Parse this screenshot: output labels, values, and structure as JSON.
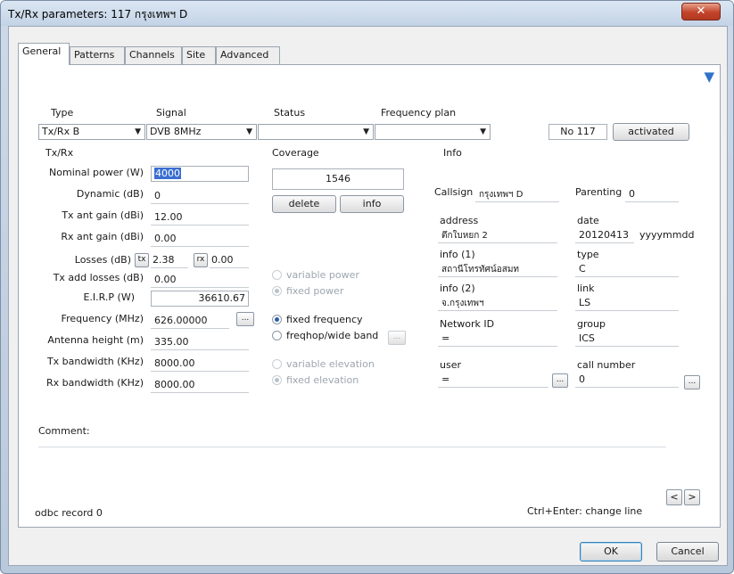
{
  "window": {
    "title": "Tx/Rx parameters: 117 กรุงเทพฯ D",
    "close_glyph": "✕"
  },
  "tabs": [
    "General",
    "Patterns",
    "Channels",
    "Site",
    "Advanced"
  ],
  "corner_glyph": "▼",
  "top": {
    "type_label": "Type",
    "signal_label": "Signal",
    "status_label": "Status",
    "freqplan_label": "Frequency plan",
    "type_value": "Tx/Rx B",
    "signal_value": "DVB 8MHz",
    "status_value": "",
    "freqplan_value": "",
    "no_value": "No 117",
    "activated_label": "activated"
  },
  "txrx": {
    "section_label": "Tx/Rx",
    "nominal_power_label": "Nominal power (W)",
    "nominal_power_value": "4000",
    "dynamic_label": "Dynamic (dB)",
    "dynamic_value": "0",
    "tx_ant_gain_label": "Tx ant gain (dBi)",
    "tx_ant_gain_value": "12.00",
    "rx_ant_gain_label": "Rx ant gain (dBi)",
    "rx_ant_gain_value": "0.00",
    "losses_label": "Losses (dB)",
    "tx_chip": "tx",
    "tx_losses_value": "2.38",
    "rx_chip": "rx",
    "rx_losses_value": "0.00",
    "tx_add_losses_label": "Tx add losses (dB)",
    "tx_add_losses_value": "0.00",
    "eirp_label": "E.I.R.P (W)",
    "eirp_value": "36610.67",
    "frequency_label": "Frequency (MHz)",
    "frequency_value": "626.00000",
    "antenna_height_label": "Antenna height (m)",
    "antenna_height_value": "335.00",
    "tx_bandwidth_label": "Tx bandwidth (KHz)",
    "tx_bandwidth_value": "8000.00",
    "rx_bandwidth_label": "Rx bandwidth (KHz)",
    "rx_bandwidth_value": "8000.00",
    "ellipsis": "..."
  },
  "coverage": {
    "label": "Coverage",
    "value": "1546",
    "delete_label": "delete",
    "info_label": "info",
    "variable_power": "variable power",
    "fixed_power": "fixed power",
    "fixed_frequency": "fixed frequency",
    "freqhop": "freqhop/wide band",
    "variable_elevation": "variable elevation",
    "fixed_elevation": "fixed elevation",
    "ellipsis": "..."
  },
  "info": {
    "label": "Info",
    "callsign_label": "Callsign",
    "callsign_value": "กรุงเทพฯ D",
    "parenting_label": "Parenting",
    "parenting_value": "0",
    "address_label": "address",
    "address_value": "ตึกใบหยก 2",
    "date_label": "date",
    "date_value": "20120413",
    "date_format": "yyyymmdd",
    "info1_label": "info (1)",
    "info1_value": "สถานีโทรทัศน์อสมท",
    "type_label": "type",
    "type_value": "C",
    "info2_label": "info (2)",
    "info2_value": "จ.กรุงเทพฯ",
    "link_label": "link",
    "link_value": "LS",
    "network_id_label": "Network ID",
    "network_id_value": "=",
    "group_label": "group",
    "group_value": "ICS",
    "user_label": "user",
    "user_value": "=",
    "call_number_label": "call number",
    "call_number_value": "0",
    "ellipsis": "..."
  },
  "comment_label": "Comment:",
  "nav": {
    "prev": "<",
    "next": ">"
  },
  "status": {
    "odbc": "odbc record 0",
    "hint": "Ctrl+Enter: change line"
  },
  "footer": {
    "ok": "OK",
    "cancel": "Cancel"
  }
}
